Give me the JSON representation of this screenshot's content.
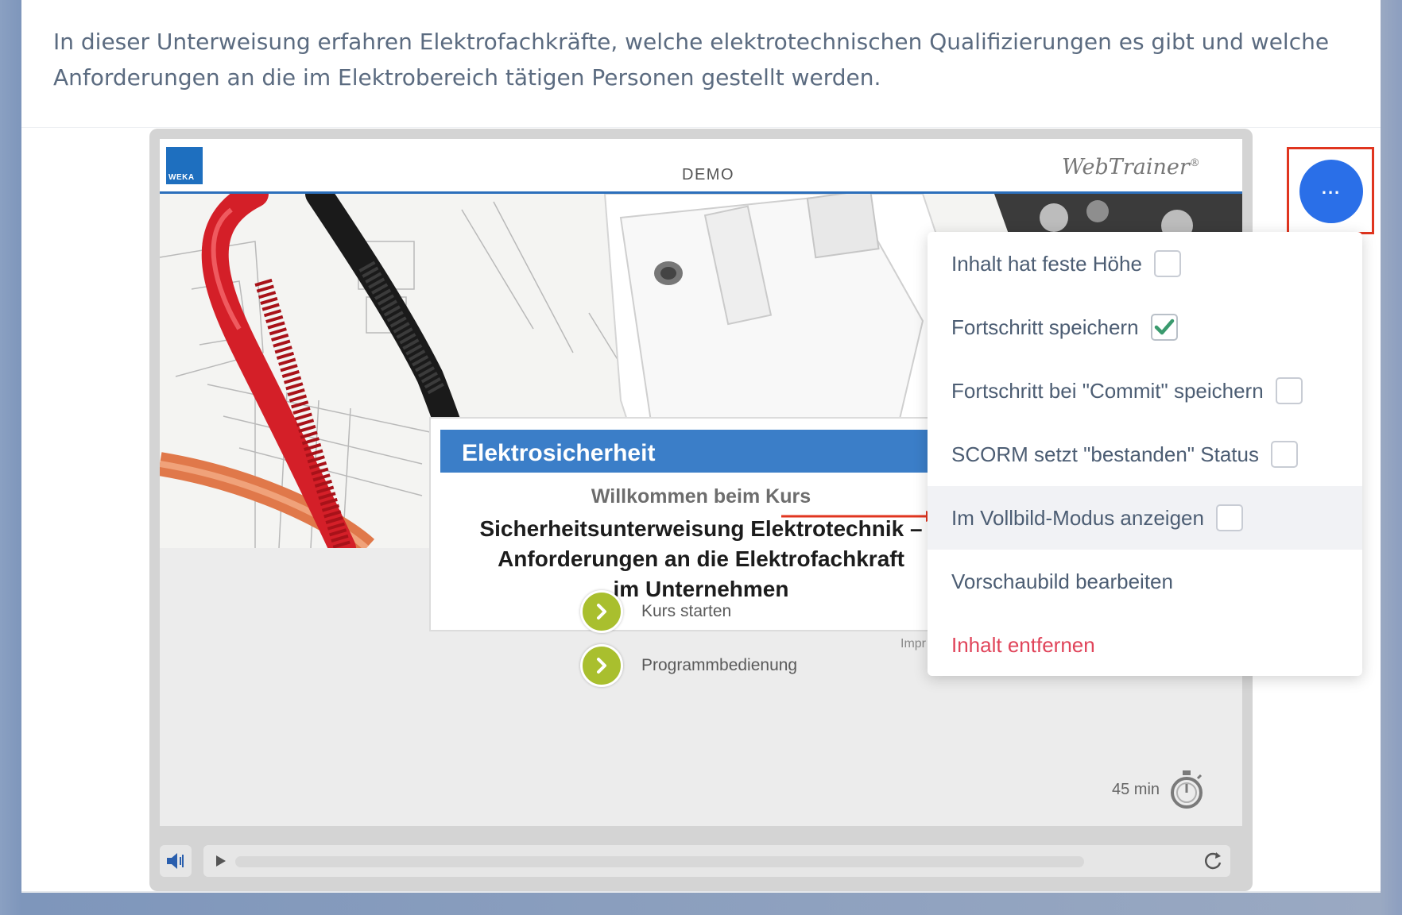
{
  "intro_text": "In dieser Unterweisung erfahren Elektrofachkräfte, welche elektrotechnischen Qualifizierungen es gibt und welche Anforderungen an die im Elektrobereich tätigen Personen gestellt werden.",
  "player": {
    "logo_text": "WEKA",
    "demo_label": "DEMO",
    "brand": "WebTrainer",
    "brand_mark": "®",
    "welcome": {
      "title": "Elektrosicherheit",
      "subtitle": "Willkommen beim Kurs",
      "course_line1": "Sicherheitsunterweisung Elektrotechnik –",
      "course_line2": "Anforderungen an die Elektrofachkraft",
      "course_line3": "im Unternehmen"
    },
    "impressum_partial": "Impr",
    "links": [
      {
        "label": "Kurs starten"
      },
      {
        "label": "Programmbedienung"
      }
    ],
    "duration": "45 min",
    "progress_percent": 0
  },
  "options_menu": {
    "items": [
      {
        "label": "Inhalt hat feste Höhe",
        "checked": false
      },
      {
        "label": "Fortschritt speichern",
        "checked": true
      },
      {
        "label": "Fortschritt bei \"Commit\" speichern",
        "checked": false
      },
      {
        "label": "SCORM setzt \"bestanden\" Status",
        "checked": false
      },
      {
        "label": "Im Vollbild-Modus anzeigen",
        "checked": false
      },
      {
        "label": "Vorschaubild bearbeiten"
      },
      {
        "label": "Inhalt entfernen"
      }
    ],
    "colors": {
      "accent": "#2a6fe8",
      "danger": "#e0445a",
      "check": "#3a9a6e",
      "highlight": "#e0351f"
    }
  }
}
